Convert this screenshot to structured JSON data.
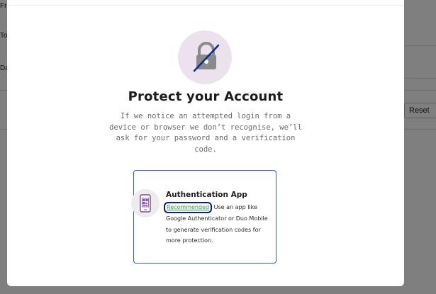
{
  "background": {
    "row_labels": [
      "Fr",
      "To",
      "Da"
    ],
    "reset_label": "Reset"
  },
  "modal": {
    "title": "Protect your Account",
    "description": "If we notice an attempted login from a device or browser we don’t recognise, we’ll ask for your password and a verification code.",
    "options": [
      {
        "title": "Authentication App",
        "badge": "Recommended",
        "description": "Use an app like Google Authenticator or Duo Mobile to generate verification codes for more protection."
      }
    ]
  },
  "colors": {
    "accent_border": "#3a5bd9",
    "badge_text": "#2f9e3a",
    "badge_outline": "#0b1f8c",
    "lock_circle": "#ece2ee"
  },
  "icons": {
    "lock": "lock-slash-icon",
    "phone": "phone-qr-icon"
  }
}
